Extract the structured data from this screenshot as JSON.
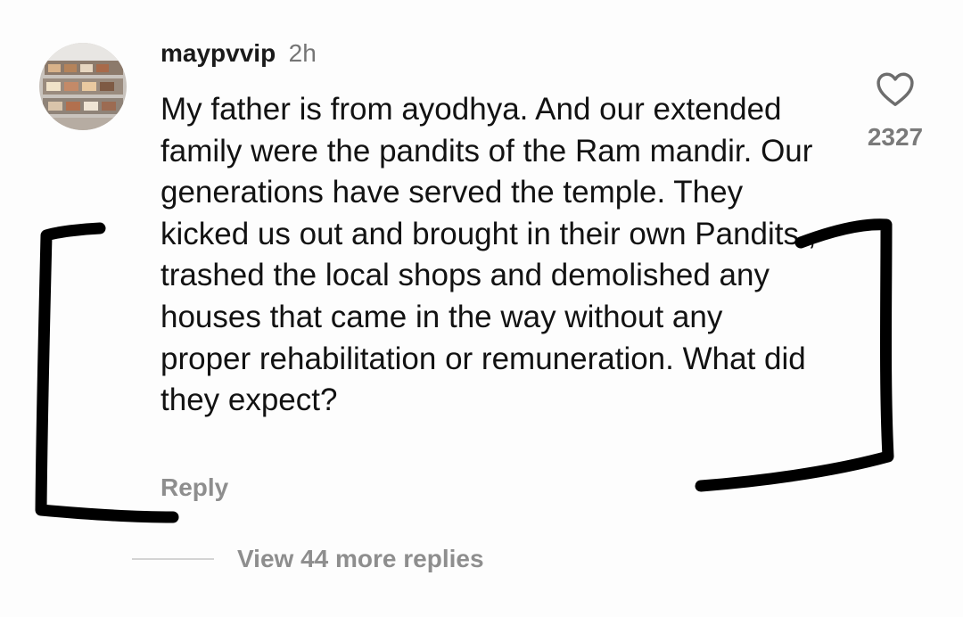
{
  "comment": {
    "username": "maypvvip",
    "time": "2h",
    "text": "My father is from ayodhya. And our extended family were the pandits of the Ram mandir. Our generations have served the temple. They kicked us out and brought in their own Pandits , trashed the local shops and demolished any houses that came in the way without any proper rehabilitation or remuneration. What did they expect?",
    "like_count": "2327",
    "reply_label": "Reply"
  },
  "replies": {
    "view_label": "View 44 more replies"
  },
  "icons": {
    "like": "heart-outline-icon"
  },
  "colors": {
    "background": "#fdfdfd",
    "text": "#121212",
    "muted": "#8e8e8e",
    "bracket_ink": "#000000"
  }
}
